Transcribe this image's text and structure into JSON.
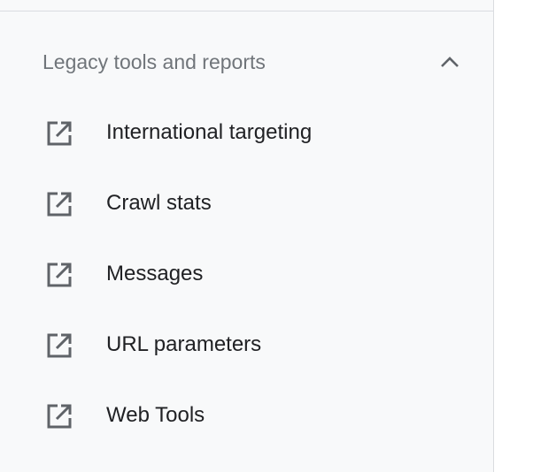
{
  "section": {
    "title": "Legacy tools and reports",
    "toggle_icon": "chevron-up-icon",
    "expanded": true
  },
  "items": [
    {
      "label": "International targeting",
      "icon": "open-in-new-icon"
    },
    {
      "label": "Crawl stats",
      "icon": "open-in-new-icon"
    },
    {
      "label": "Messages",
      "icon": "open-in-new-icon"
    },
    {
      "label": "URL parameters",
      "icon": "open-in-new-icon"
    },
    {
      "label": "Web Tools",
      "icon": "open-in-new-icon"
    }
  ],
  "colors": {
    "sidebar_bg": "#f8f9fa",
    "divider": "#dadce0",
    "header_text": "#70757a",
    "item_text": "#202124",
    "icon": "#5f6368"
  }
}
